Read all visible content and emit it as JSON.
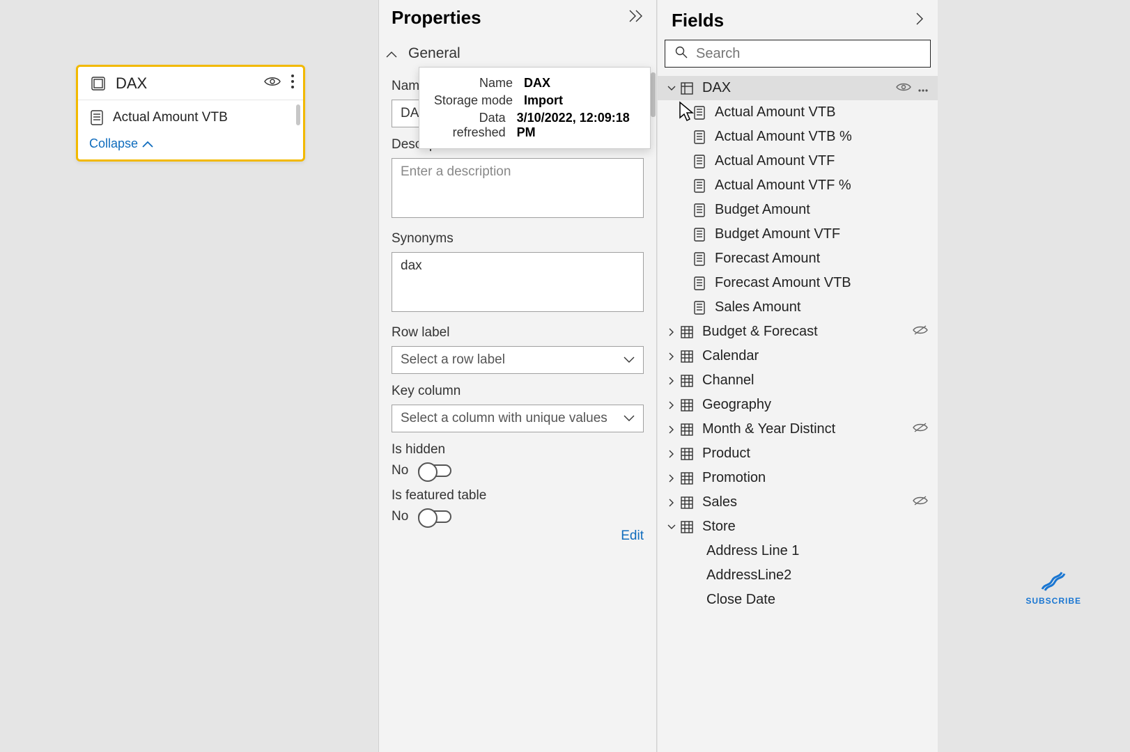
{
  "canvas": {
    "table_title": "DAX",
    "measure_label": "Actual Amount VTB",
    "collapse_label": "Collapse"
  },
  "properties": {
    "panel_title": "Properties",
    "section_general": "General",
    "name_label": "Name",
    "name_value": "DAX",
    "description_label": "Description",
    "description_placeholder": "Enter a description",
    "synonyms_label": "Synonyms",
    "synonyms_value": "dax",
    "row_label_label": "Row label",
    "row_label_placeholder": "Select a row label",
    "key_column_label": "Key column",
    "key_column_placeholder": "Select a column with unique values",
    "is_hidden_label": "Is hidden",
    "is_hidden_value": "No",
    "is_featured_label": "Is featured table",
    "is_featured_value": "No",
    "edit_label": "Edit"
  },
  "tooltip": {
    "k1": "Name",
    "v1": "DAX",
    "k2": "Storage mode",
    "v2": "Import",
    "k3": "Data refreshed",
    "v3": "3/10/2022, 12:09:18 PM"
  },
  "fields": {
    "panel_title": "Fields",
    "search_placeholder": "Search",
    "dax_label": "DAX",
    "dax_measures": {
      "m0": "Actual Amount VTB",
      "m1": "Actual Amount VTB %",
      "m2": "Actual Amount VTF",
      "m3": "Actual Amount VTF %",
      "m4": "Budget Amount",
      "m5": "Budget Amount VTF",
      "m6": "Forecast Amount",
      "m7": "Forecast Amount VTB",
      "m8": "Sales Amount"
    },
    "tables": {
      "t0": "Budget & Forecast",
      "t1": "Calendar",
      "t2": "Channel",
      "t3": "Geography",
      "t4": "Month & Year Distinct",
      "t5": "Product",
      "t6": "Promotion",
      "t7": "Sales",
      "t8": "Store"
    },
    "store_columns": {
      "c0": "Address Line 1",
      "c1": "AddressLine2",
      "c2": "Close Date"
    }
  },
  "subscribe_label": "SUBSCRIBE"
}
